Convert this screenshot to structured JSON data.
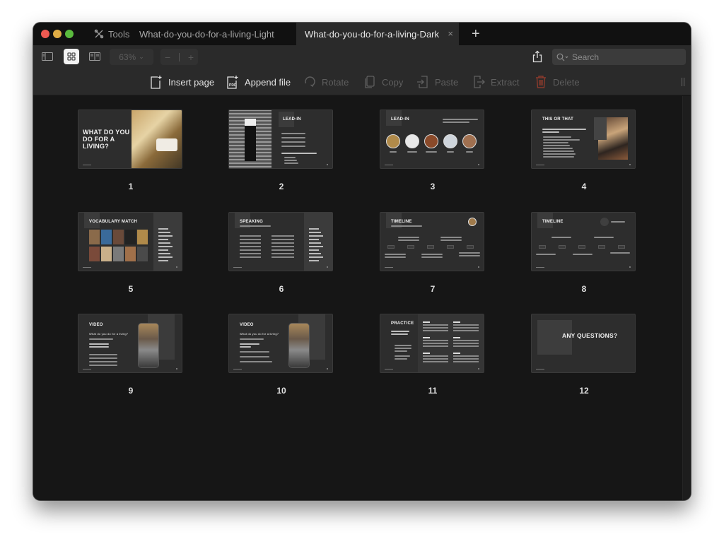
{
  "window": {
    "tools_tab_label": "Tools",
    "tabs": [
      {
        "label": "What-do-you-do-for-a-living-Light",
        "active": false
      },
      {
        "label": "What-do-you-do-for-a-living-Dark",
        "active": true,
        "close_icon": "×"
      }
    ],
    "new_tab_label": "+"
  },
  "toolbar": {
    "view_modes": [
      "sidebar-view",
      "grid-view",
      "two-page-view"
    ],
    "active_view": "grid-view",
    "zoom_level": "63%",
    "zoom_out_label": "−",
    "zoom_in_label": "+",
    "search_placeholder": "Search",
    "actions": [
      {
        "label": "Insert page",
        "icon": "insert-page-icon",
        "enabled": true
      },
      {
        "label": "Append file",
        "icon": "append-pdf-icon",
        "enabled": true
      },
      {
        "label": "Rotate",
        "icon": "rotate-icon",
        "enabled": false
      },
      {
        "label": "Copy",
        "icon": "copy-icon",
        "enabled": false
      },
      {
        "label": "Paste",
        "icon": "paste-icon",
        "enabled": false
      },
      {
        "label": "Extract",
        "icon": "extract-icon",
        "enabled": false
      },
      {
        "label": "Delete",
        "icon": "trash-icon",
        "enabled": false
      }
    ]
  },
  "colors": {
    "window_bg": "#161616",
    "toolbar_bg": "#2a2a2a",
    "delete_icon": "#8a3a2c",
    "traffic_red": "#ee5a52",
    "traffic_yellow": "#e0ad45",
    "traffic_green": "#5bbb3e"
  },
  "pages": [
    {
      "number": "1",
      "title": "WHAT DO YOU DO FOR A LIVING?"
    },
    {
      "number": "2",
      "title": "LEAD-IN"
    },
    {
      "number": "3",
      "title": "LEAD-IN"
    },
    {
      "number": "4",
      "title": "THIS OR THAT"
    },
    {
      "number": "5",
      "title": "VOCABULARY MATCH"
    },
    {
      "number": "6",
      "title": "SPEAKING"
    },
    {
      "number": "7",
      "title": "TIMELINE"
    },
    {
      "number": "8",
      "title": "TIMELINE"
    },
    {
      "number": "9",
      "title": "VIDEO",
      "subtitle": "What do you do for a living?"
    },
    {
      "number": "10",
      "title": "VIDEO",
      "subtitle": "What do you do for a living?"
    },
    {
      "number": "11",
      "title": "PRACTICE"
    },
    {
      "number": "12",
      "title": "ANY QUESTIONS?"
    }
  ]
}
